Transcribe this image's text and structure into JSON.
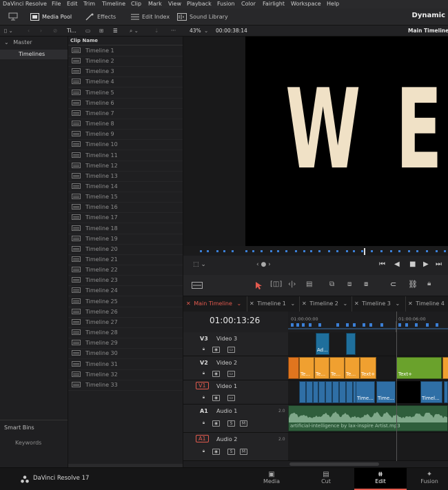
{
  "menubar": {
    "app_name": "DaVinci Resolve",
    "items": [
      "File",
      "Edit",
      "Trim",
      "Timeline",
      "Clip",
      "Mark",
      "View",
      "Playback",
      "Fusion",
      "Color",
      "Fairlight",
      "Workspace",
      "Help"
    ]
  },
  "toolbar": {
    "media_pool": "Media Pool",
    "effects": "Effects",
    "edit_index": "Edit Index",
    "sound_library": "Sound Library",
    "project_title": "Dynamic"
  },
  "subbar": {
    "bin_short": "Ti...",
    "zoom": "43%",
    "viewer_timecode": "00:00:38:14",
    "viewer_title": "Main Timeline"
  },
  "bins": {
    "master": "Master",
    "timelines": "Timelines",
    "smart_bins": "Smart Bins",
    "keywords": "Keywords"
  },
  "clip_list": {
    "header": "Clip Name",
    "items": [
      "Timeline 1",
      "Timeline 2",
      "Timeline 3",
      "Timeline 4",
      "Timeline 5",
      "Timeline 6",
      "Timeline 7",
      "Timeline 8",
      "Timeline 9",
      "Timeline 10",
      "Timeline 11",
      "Timeline 12",
      "Timeline 13",
      "Timeline 14",
      "Timeline 15",
      "Timeline 16",
      "Timeline 17",
      "Timeline 18",
      "Timeline 19",
      "Timeline 20",
      "Timeline 21",
      "Timeline 22",
      "Timeline 23",
      "Timeline 24",
      "Timeline 25",
      "Timeline 26",
      "Timeline 27",
      "Timeline 28",
      "Timeline 29",
      "Timeline 30",
      "Timeline 31",
      "Timeline 32",
      "Timeline 33"
    ]
  },
  "viewer": {
    "letters": [
      "W",
      "E"
    ]
  },
  "timeline_tabs": [
    {
      "label": "Main Timeline",
      "active": true
    },
    {
      "label": "Timeline 1",
      "active": false
    },
    {
      "label": "Timeline 2",
      "active": false
    },
    {
      "label": "Timeline 3",
      "active": false
    },
    {
      "label": "Timeline 4",
      "active": false
    }
  ],
  "timeline": {
    "timecode": "01:00:13:26",
    "ruler_labels": [
      "01:00:00:00",
      "01:00:06:00"
    ],
    "tracks": [
      {
        "id": "V3",
        "name": "Video 3",
        "kind": "video"
      },
      {
        "id": "V2",
        "name": "Video 2",
        "kind": "video"
      },
      {
        "id": "V1",
        "name": "Video 1",
        "kind": "video",
        "boxed": true
      },
      {
        "id": "A1",
        "name": "Audio 1",
        "kind": "audio",
        "level": "2.0"
      },
      {
        "id": "A1",
        "name": "Audio 2",
        "kind": "audio",
        "level": "2.0",
        "boxed": true
      }
    ],
    "v3_clips": [
      "Ad..."
    ],
    "v2_clips": [
      "Te...",
      "Te...",
      "Te...",
      "Te...",
      "Text+",
      "Text+"
    ],
    "v1_clips": [
      "Time...",
      "Time...",
      "Timel..."
    ],
    "audio_clip": "artificial-intelligence by lax-inspire Artist.mp3",
    "track_btn_s": "S",
    "track_btn_m": "M"
  },
  "bottombar": {
    "product": "DaVinci Resolve 17",
    "pages": [
      {
        "label": "Media",
        "active": false
      },
      {
        "label": "Cut",
        "active": false
      },
      {
        "label": "Edit",
        "active": true
      },
      {
        "label": "Fusion",
        "active": false
      }
    ]
  },
  "colors": {
    "accent_red": "#e35a4e",
    "clip_orange": "#f0a030",
    "clip_green": "#6aa22c",
    "clip_blue": "#3d7eb8",
    "audio_green": "#3f7a4e",
    "title_cream": "#f0e1c6"
  }
}
